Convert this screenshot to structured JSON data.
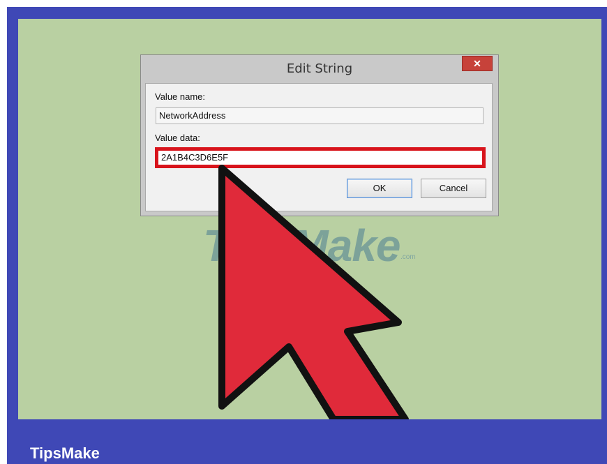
{
  "dialog": {
    "title": "Edit String",
    "close_label": "✕",
    "value_name_label": "Value name:",
    "value_name": "NetworkAddress",
    "value_data_label": "Value data:",
    "value_data": "2A1B4C3D6E5F",
    "ok_label": "OK",
    "cancel_label": "Cancel"
  },
  "watermark": {
    "text": "TipsMake",
    "suffix": ".com"
  },
  "caption": "TipsMake",
  "colors": {
    "frame": "#3f48b6",
    "stage": "#b9d0a2",
    "highlight": "#d8141c",
    "arrow_fill": "#e02a3a",
    "arrow_stroke": "#111111"
  },
  "icons": {
    "close": "close-icon",
    "pointer": "arrow-pointer-icon"
  }
}
